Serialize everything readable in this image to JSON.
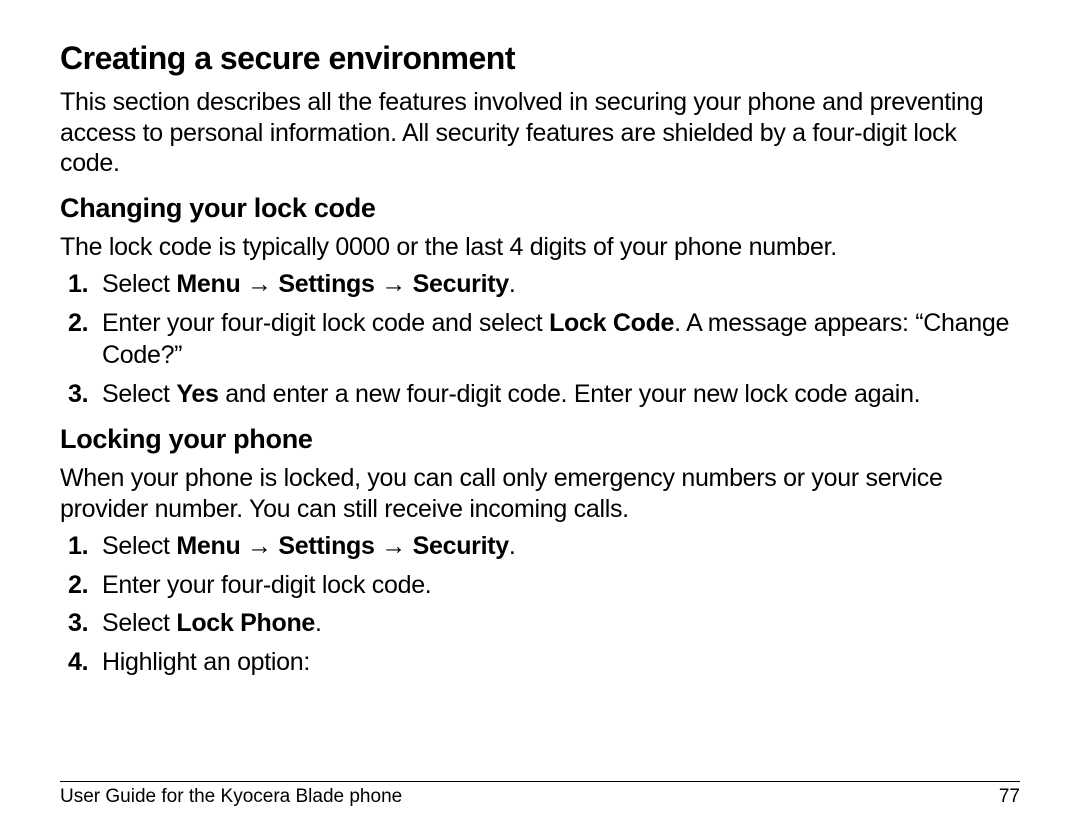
{
  "h1": "Creating a secure environment",
  "intro": "This section describes all the features involved in securing your phone and preventing access to personal information. All security features are shielded by a four-digit lock code.",
  "section1": {
    "heading": "Changing your lock code",
    "intro": "The lock code is typically 0000 or the last 4 digits of your phone number.",
    "step1_prefix": "Select ",
    "step1_bold": "Menu → Settings → Security",
    "step1_suffix": ".",
    "step2_prefix": "Enter your four-digit lock code and select ",
    "step2_bold": "Lock Code",
    "step2_suffix": ". A message appears: “Change Code?”",
    "step3_prefix": "Select ",
    "step3_bold": "Yes",
    "step3_suffix": " and enter a new four-digit code. Enter your new lock code again."
  },
  "section2": {
    "heading": "Locking your phone",
    "intro": "When your phone is locked, you can call only emergency numbers or your service provider number. You can still receive incoming calls.",
    "step1_prefix": "Select ",
    "step1_bold": "Menu → Settings → Security",
    "step1_suffix": ".",
    "step2": "Enter your four-digit lock code.",
    "step3_prefix": "Select ",
    "step3_bold": "Lock Phone",
    "step3_suffix": ".",
    "step4": "Highlight an option:"
  },
  "footer": {
    "left": "User Guide for the Kyocera Blade phone",
    "right": "77"
  }
}
